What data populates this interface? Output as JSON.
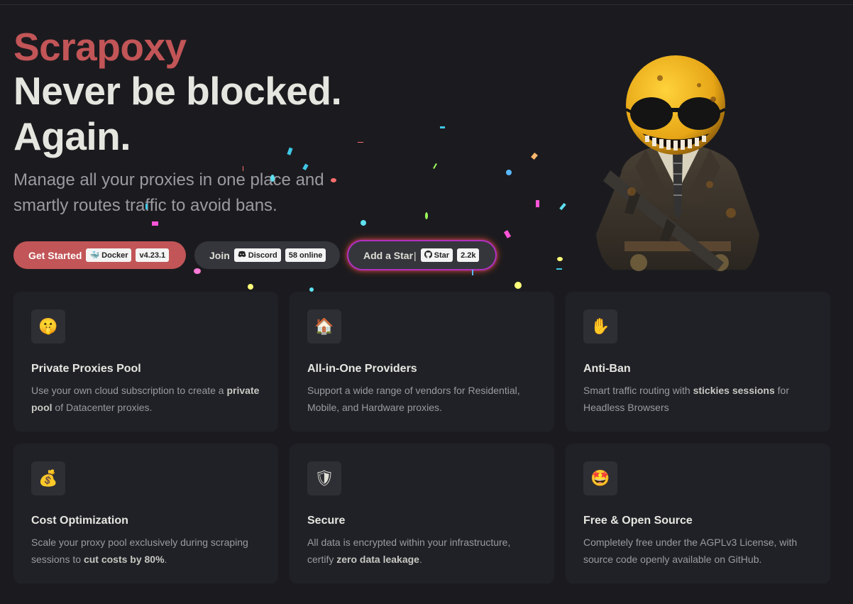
{
  "hero": {
    "name": "Scrapoxy",
    "text": "Never be blocked. Again.",
    "tagline": "Manage all your proxies in one place and smartly routes traffic to avoid bans."
  },
  "actions": {
    "get_started": {
      "label": "Get Started",
      "chip_label": "Docker",
      "chip_value": "v4.23.1"
    },
    "join": {
      "label": "Join",
      "chip_label": "Discord",
      "chip_value": "58 online"
    },
    "star": {
      "label": "Add a Star",
      "separator": "|",
      "chip_label": "Star",
      "chip_value": "2.2k"
    }
  },
  "features": [
    {
      "icon": "🤫",
      "icon_name": "shushing-face-icon",
      "title": "Private Proxies Pool",
      "desc_pre": "Use your own cloud subscription to create a ",
      "desc_bold": "private pool",
      "desc_post": " of Datacenter proxies."
    },
    {
      "icon": "🏠",
      "icon_name": "house-icon",
      "title": "All-in-One Providers",
      "desc_pre": "Support a wide range of vendors for Residential, Mobile, and Hardware proxies.",
      "desc_bold": "",
      "desc_post": ""
    },
    {
      "icon": "✋",
      "icon_name": "raised-hand-icon",
      "title": "Anti-Ban",
      "desc_pre": "Smart traffic routing with ",
      "desc_bold": "stickies sessions",
      "desc_post": " for Headless Browsers"
    },
    {
      "icon": "💰",
      "icon_name": "money-bag-icon",
      "title": "Cost Optimization",
      "desc_pre": "Scale your proxy pool exclusively during scraping sessions to ",
      "desc_bold": "cut costs by 80%",
      "desc_post": "."
    },
    {
      "icon": "🛡",
      "icon_name": "shield-icon",
      "title": "Secure",
      "desc_pre": "All data is encrypted within your infrastructure, certify ",
      "desc_bold": "zero data leakage",
      "desc_post": "."
    },
    {
      "icon": "🤩",
      "icon_name": "star-struck-icon",
      "title": "Free & Open Source",
      "desc_pre": "Completely free under the AGPLv3 License, with source code openly available on GitHub.",
      "desc_bold": "",
      "desc_post": ""
    }
  ],
  "colors": {
    "accent": "#c25557",
    "background": "#1b1b1f",
    "card": "#202127",
    "button_alt": "#35363c"
  }
}
